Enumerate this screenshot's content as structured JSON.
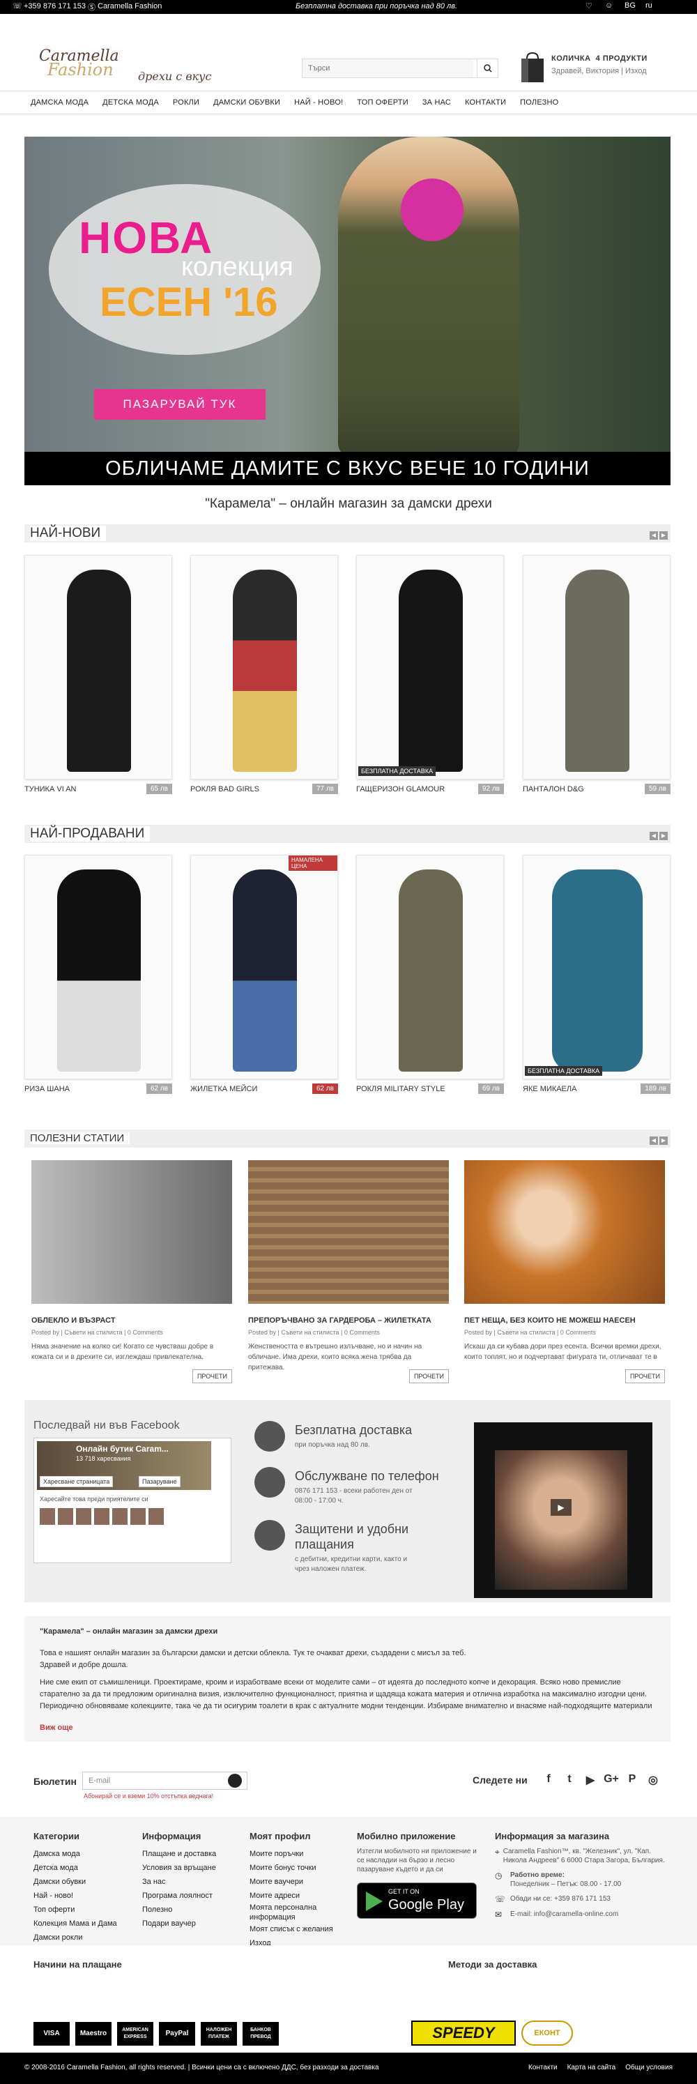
{
  "topbar": {
    "phone": "+359 876 171 153",
    "skype": "Caramella Fashion",
    "promo": "Безплатна доставка при поръчка над 80 лв.",
    "lang": "BG",
    "flag": "ru"
  },
  "header": {
    "logo_line1": "Caramella",
    "logo_line2": "Fashion",
    "slogan": "дрехи с вкус",
    "search_placeholder": "Търси",
    "cart_label": "КОЛИЧКА",
    "cart_count": "4 ПРОДУКТИ",
    "greeting": "Здравей, Виктория",
    "logout": "Изход"
  },
  "nav": [
    "ДАМСКА МОДА",
    "ДЕТСКА МОДА",
    "РОКЛИ",
    "ДАМСКИ ОБУВКИ",
    "НАЙ - НОВО!",
    "ТОП ОФЕРТИ",
    "ЗА НАС",
    "КОНТАКТИ",
    "ПОЛЕЗНО"
  ],
  "hero": {
    "line1": "НОВА",
    "line2": "колекция",
    "line3": "ЕСЕН '16",
    "cta": "ПАЗАРУВАЙ ТУК",
    "band": "ОБЛИЧАМЕ ДАМИТЕ С ВКУС ВЕЧЕ 10 ГОДИНИ"
  },
  "tagline": "\"Карамела\" – онлайн магазин за дамски дрехи",
  "newest": {
    "title": "НАЙ-НОВИ",
    "items": [
      {
        "name": "ТУНИКА VI AN",
        "price": "65 лв",
        "badge": "",
        "color": "#1b1b1b"
      },
      {
        "name": "РОКЛЯ BAD GIRLS",
        "price": "77 лв",
        "badge": "",
        "color": "#2a2a2a"
      },
      {
        "name": "ГАЩЕРИЗОН GLAMOUR",
        "price": "92 лв",
        "badge": "БЕЗПЛАТНА ДОСТАВКА",
        "color": "#151515"
      },
      {
        "name": "ПАНТАЛОН D&G",
        "price": "59 лв",
        "badge": "",
        "color": "#6d6b5e"
      }
    ]
  },
  "bestsellers": {
    "title": "НАЙ-ПРОДАВАНИ",
    "items": [
      {
        "name": "РИЗА ШАНА",
        "price": "62 лв",
        "badge": "",
        "color": "#111",
        "sale": false
      },
      {
        "name": "ЖИЛЕТКА МЕЙСИ",
        "price": "62 лв",
        "badge": "НАМАЛЕНА ЦЕНА",
        "color": "#1e2233",
        "sale": true
      },
      {
        "name": "РОКЛЯ MILITARY STYLE",
        "price": "69 лв",
        "badge": "",
        "color": "#6b6750",
        "sale": false
      },
      {
        "name": "ЯКЕ МИКАЕЛА",
        "price": "189 лв",
        "badge": "БЕЗПЛАТНА ДОСТАВКА",
        "color": "#2c6e8a",
        "sale": false
      }
    ]
  },
  "articles": {
    "title": "ПОЛЕЗНИ СТАТИИ",
    "posted_by": "Posted by",
    "read_more": "ПРОЧЕТИ",
    "items": [
      {
        "title": "ОБЛЕКЛО И ВЪЗРАСТ",
        "author": "Съвети на стилиста",
        "comments": "0 Comments",
        "excerpt": "Няма значение на колко си! Когато се чувстваш добре в кожата си и в дрехите си, изглеждаш привлекателна.",
        "bg": "#8e8e8e"
      },
      {
        "title": "ПРЕПОРЪЧВАНО ЗА ГАРДЕРОБА – ЖИЛЕТКАТА",
        "author": "Съвети на стилиста",
        "comments": "0 Comments",
        "excerpt": "Женствеността е вътрешно излъчване, но и начин на обличане. Има дрехи, които всяка жена трябва да притежава.",
        "bg": "#8a6a4a"
      },
      {
        "title": "ПЕТ НЕЩА, БЕЗ КОИТО НЕ МОЖЕШ НАЕСЕН",
        "author": "Съвети на стилиста",
        "comments": "0 Comments",
        "excerpt": "Искаш да си кубава дори през есента. Всички времки дрехи, които топлят, но и подчертават фигурата ти, отличават те в",
        "bg": "#c9752a"
      }
    ]
  },
  "facebook": {
    "title": "Последвай ни във Facebook",
    "page": "Онлайн бутик Caram...",
    "likes": "13 718 харесвания",
    "like_btn": "Харесване страницата",
    "shop_btn": "Пазаруване",
    "friends": "Харесайте това преди приятелите си"
  },
  "services": [
    {
      "title": "Безплатна доставка",
      "desc": "при поръчка над 80 лв."
    },
    {
      "title": "Обслужване по телефон",
      "desc": "0876 171 153 - всеки работен ден от 08:00 - 17:00 ч."
    },
    {
      "title": "Защитени и удобни плащания",
      "desc": "с дебитни, кредитни карти, както и чрез наложен платеж."
    }
  ],
  "about": {
    "title": "\"Карамела\" – онлайн магазин за дамски дрехи",
    "p1": "Това е нашият онлайн магазин за български дамски и детски облекла. Тук те очакват дрехи, създадени с мисъл за теб.",
    "p2": "Здравей и добре дошла.",
    "p3": "Ние сме екип от съмишленици. Проектираме, кроим и изработваме всеки от моделите сами – от идеята до последното копче и декорация. Всяко ново премислие старателно за да ти предложим оригинална визия, изключително функционалност, приятна и щадяща кожата материя и отлична изработка на максимално изгодни цени. Периодично обновяваме колекциите, така че да ти осигурим тоалети в крак с актуалните модни тенденции. Избираме внимателно и внасяме най-подходящите материали",
    "more": "Виж още"
  },
  "newsletter": {
    "title": "Бюлетин",
    "placeholder": "E-mail",
    "subtitle": "Абонирай се и вземи 10% отстъпка веднага!",
    "follow": "Следете ни"
  },
  "footer": {
    "categories": {
      "title": "Категории",
      "items": [
        "Дамска мода",
        "Детска мода",
        "Дамски обувки",
        "Най - ново!",
        "Топ оферти",
        "Колекция Мама и Дама",
        "Дамски рокли"
      ]
    },
    "info": {
      "title": "Информация",
      "items": [
        "Плащане и доставка",
        "Условия за връщане",
        "За нас",
        "Програма лоялност",
        "Полезно",
        "Подари ваучер"
      ]
    },
    "profile": {
      "title": "Моят профил",
      "items": [
        "Моите поръчки",
        "Моите бонус точки",
        "Моите ваучери",
        "Моите адреси",
        "Моята персонална информация",
        "Моят списък с желания",
        "Изход"
      ]
    },
    "mobile": {
      "title": "Мобилно приложение",
      "desc": "Изтегли мобилното ни приложение и се насладии на бързо и лесно пазаруване където и да си",
      "get_on": "GET IT ON",
      "store": "Google Play"
    },
    "shop": {
      "title": "Информация за магазина",
      "address": "Caramella Fashion™, кв. \"Железник\", ул. \"Кап. Никола Андреев\" 6 6000 Стара Загора, България.",
      "hours_label": "Работно време:",
      "hours": "Понеделник – Петък: 08.00 - 17.00",
      "phone": "Обади ни се: +359 876 171 153",
      "email": "E-mail: info@caramella-online.com"
    }
  },
  "payment": {
    "title": "Начини на плащане",
    "cards": [
      "VISA",
      "Maestro",
      "AMERICAN EXPRESS",
      "PayPal",
      "НАЛОЖЕН ПЛАТЕЖ",
      "БАНКОВ ПРЕВОД"
    ],
    "delivery_title": "Методи за доставка",
    "courier1": "SPEEDY",
    "courier2": "ЕКОНТ"
  },
  "bottom": {
    "copyright": "© 2008-2016 Caramella Fashion, all rights reserved. | Всички цени са с включено ДДС, без разходи за доставка",
    "links": [
      "Контакти",
      "Карта на сайта",
      "Общи условия"
    ]
  },
  "colors": {
    "accent": "#e5358e",
    "sale": "#c03a3a",
    "gold": "#c9a86b"
  }
}
